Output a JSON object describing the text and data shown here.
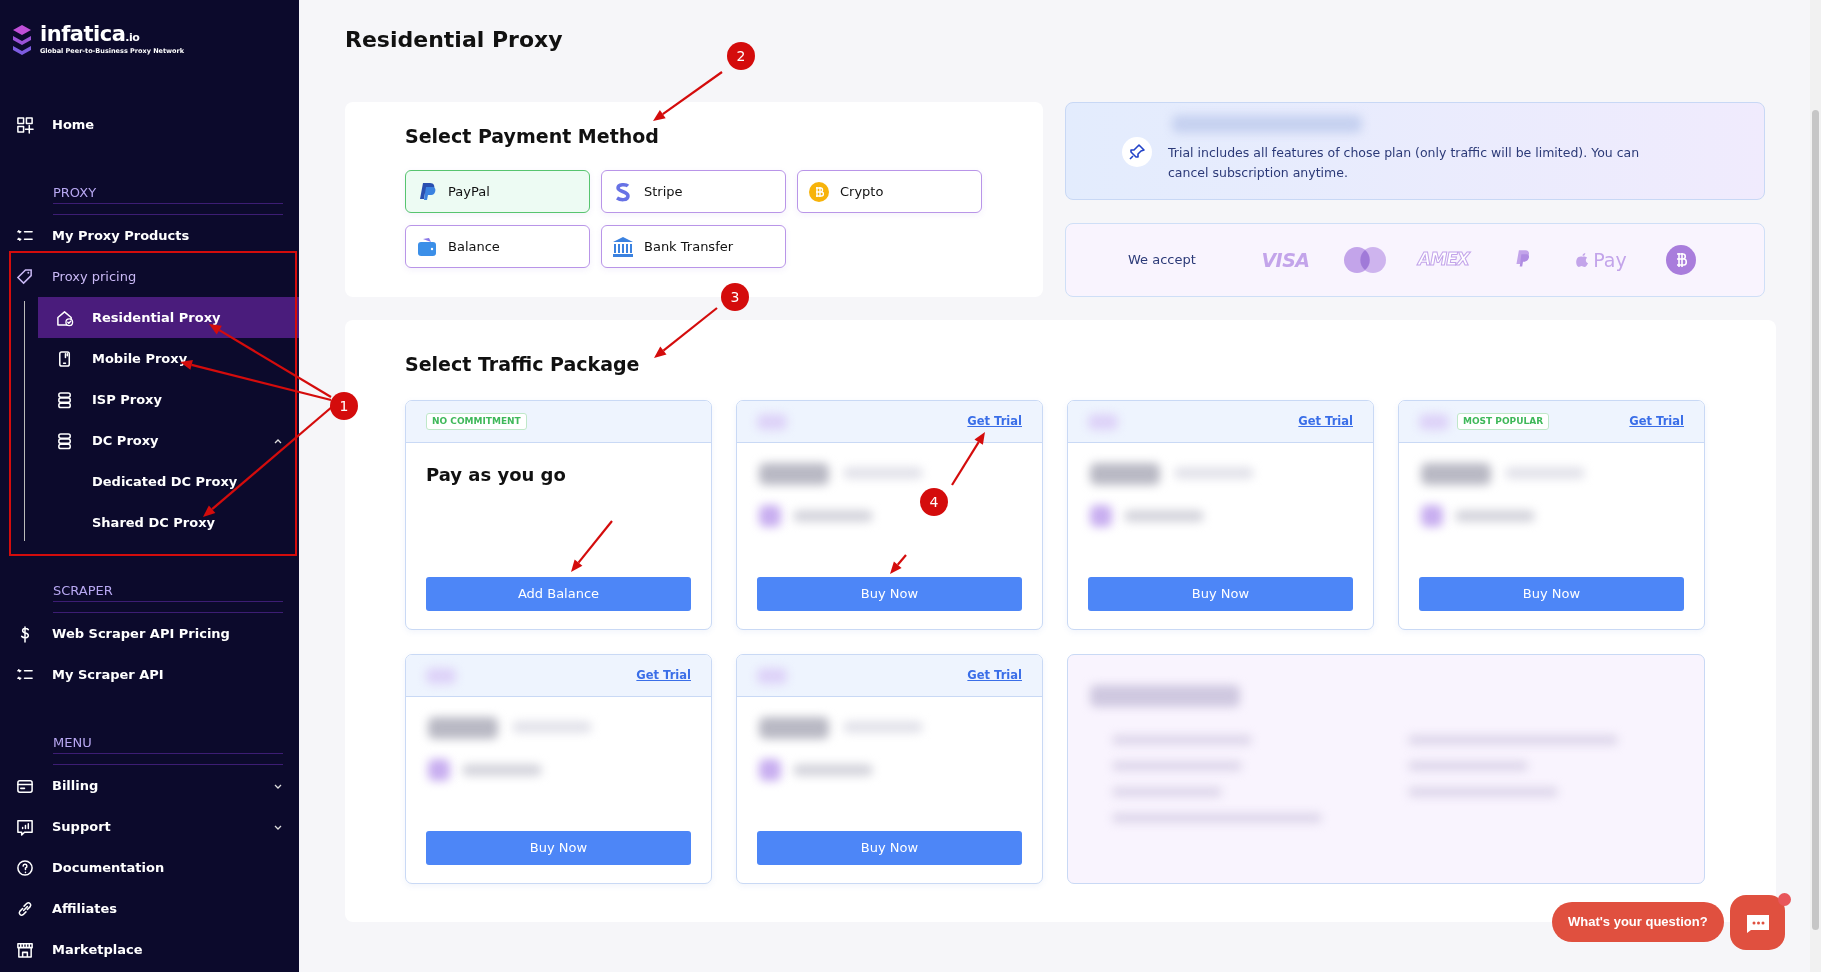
{
  "sidebar": {
    "logo": {
      "name": "infatica",
      "suffix": ".io",
      "tagline": "Global Peer-to-Business Proxy Network"
    },
    "sections": [
      {
        "items": [
          {
            "label": "Home",
            "selected": false
          }
        ]
      },
      {
        "heading": "PROXY",
        "items": [
          {
            "label": "My Proxy Products",
            "selected": false
          },
          {
            "label": "Proxy pricing",
            "selected": false,
            "children": [
              {
                "label": "Residential Proxy",
                "selected": true
              },
              {
                "label": "Mobile Proxy",
                "selected": false
              },
              {
                "label": "ISP Proxy",
                "selected": false
              },
              {
                "label": "DC Proxy",
                "selected": false,
                "expanded": true,
                "children": [
                  {
                    "label": "Dedicated DC Proxy",
                    "selected": false
                  },
                  {
                    "label": "Shared DC Proxy",
                    "selected": false
                  }
                ]
              }
            ]
          }
        ]
      },
      {
        "heading": "SCRAPER",
        "items": [
          {
            "label": "Web Scraper API Pricing",
            "selected": false
          },
          {
            "label": "My Scraper API",
            "selected": false
          }
        ]
      },
      {
        "heading": "MENU",
        "items": [
          {
            "label": "Billing",
            "selected": false,
            "expanded": false
          },
          {
            "label": "Support",
            "selected": false,
            "expanded": false
          },
          {
            "label": "Documentation",
            "selected": false
          },
          {
            "label": "Affiliates",
            "selected": false
          },
          {
            "label": "Marketplace",
            "selected": false
          }
        ]
      }
    ]
  },
  "page_title": "Residential Proxy",
  "payment": {
    "title": "Select Payment Method",
    "methods": [
      {
        "label": "PayPal",
        "selected": true
      },
      {
        "label": "Stripe",
        "selected": false
      },
      {
        "label": "Crypto",
        "selected": false
      },
      {
        "label": "Balance",
        "selected": false
      },
      {
        "label": "Bank Transfer",
        "selected": false
      }
    ]
  },
  "trial_note": {
    "text": "Trial includes all features of chose plan (only traffic will be limited). You can cancel subscription anytime."
  },
  "accepted": {
    "label": "We accept",
    "logos": [
      {
        "kind": "visa",
        "text": "VISA"
      },
      {
        "kind": "mastercard"
      },
      {
        "kind": "amex",
        "text": "AMEX"
      },
      {
        "kind": "paypal"
      },
      {
        "kind": "applepay",
        "text": "Pay"
      },
      {
        "kind": "bitcoin"
      }
    ]
  },
  "packages": {
    "title": "Select Traffic Package",
    "cards": [
      {
        "kind": "payg",
        "badge": "NO COMMITMENT",
        "title": "Pay as you go",
        "button": "Add Balance"
      },
      {
        "kind": "plan",
        "trial": "Get Trial",
        "button": "Buy Now"
      },
      {
        "kind": "plan",
        "trial": "Get Trial",
        "button": "Buy Now"
      },
      {
        "kind": "plan",
        "badge": "MOST POPULAR",
        "trial": "Get Trial",
        "button": "Buy Now"
      },
      {
        "kind": "plan",
        "trial": "Get Trial",
        "button": "Buy Now"
      },
      {
        "kind": "plan",
        "trial": "Get Trial",
        "button": "Buy Now"
      },
      {
        "kind": "blurred"
      }
    ]
  },
  "chat": {
    "prompt": "What's your question?",
    "unread": true
  },
  "annotations": [
    {
      "label": "1"
    },
    {
      "label": "2"
    },
    {
      "label": "3"
    },
    {
      "label": "4"
    }
  ]
}
